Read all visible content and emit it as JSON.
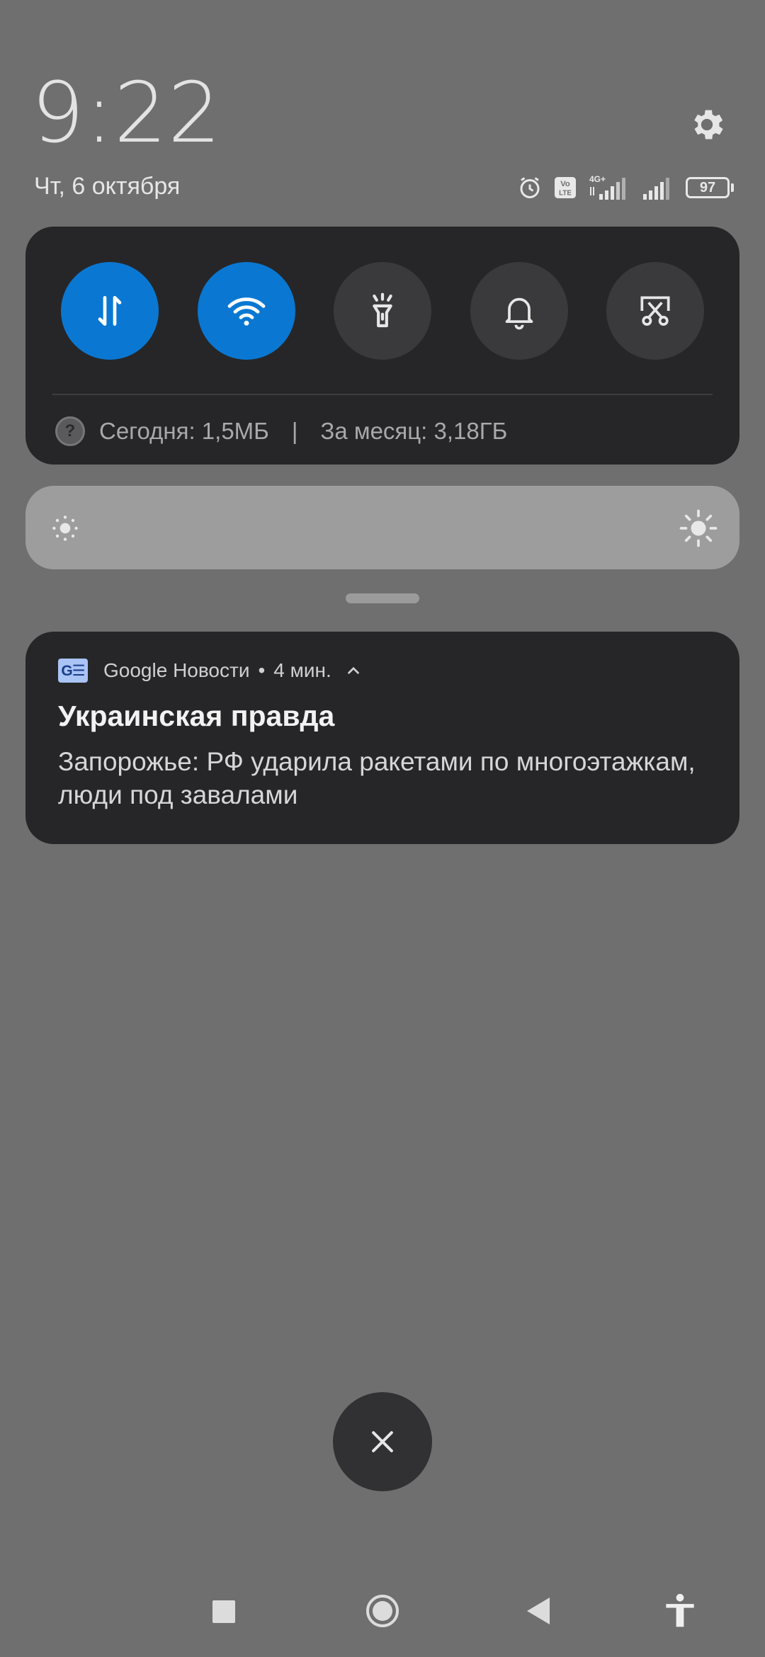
{
  "header": {
    "time": "9:22",
    "date": "Чт, 6 октября"
  },
  "status_bar": {
    "icons": [
      "alarm-icon",
      "volte-icon",
      "signal-4g-icon",
      "signal-icon"
    ],
    "volte_label": "Vo LTE",
    "network_label": "4G+",
    "battery_level": "97"
  },
  "quick_settings": {
    "toggles": [
      {
        "name": "mobile-data",
        "icon": "data-transfer-icon",
        "active": true
      },
      {
        "name": "wifi",
        "icon": "wifi-icon",
        "active": true
      },
      {
        "name": "flashlight",
        "icon": "flashlight-icon",
        "active": false
      },
      {
        "name": "sound",
        "icon": "bell-icon",
        "active": false
      },
      {
        "name": "screenshot",
        "icon": "screenshot-scissors-icon",
        "active": false
      }
    ],
    "data_usage": {
      "today": "Сегодня: 1,5МБ",
      "separator": "|",
      "month": "За месяц: 3,18ГБ"
    }
  },
  "notification": {
    "app_name": "Google Новости",
    "app_icon_text": "G☰",
    "separator": "•",
    "time_ago": "4 мин.",
    "title": "Украинская правда",
    "body": "Запорожье: РФ ударила ракетами по многоэтажкам, люди под завалами"
  },
  "colors": {
    "background": "#6f6f6f",
    "panel": "#262628",
    "accent": "#0a78d2",
    "brightness_track": "#9d9d9d"
  }
}
